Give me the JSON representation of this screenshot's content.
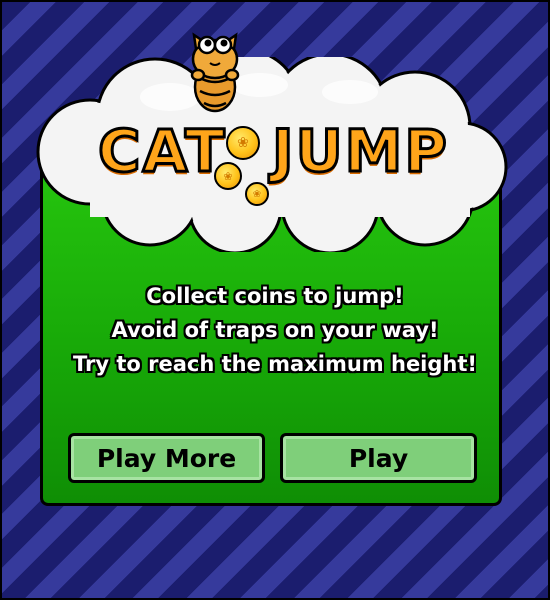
{
  "title": {
    "word_left": "CAT",
    "word_right": "JUMP"
  },
  "instructions": [
    "Collect coins to jump!",
    "Avoid of traps on your way!",
    "Try to reach the maximum height!"
  ],
  "buttons": {
    "play_more": "Play More",
    "play": "Play"
  },
  "colors": {
    "background_dark": "#1b1d6e",
    "background_light": "#363a9c",
    "panel_green": "#18aa08",
    "button_green": "#7fcf7a",
    "logo_orange": "#ffa51a",
    "coin_gold": "#ffc21a"
  },
  "icons": [
    "cat-character-icon",
    "paw-coin-icon",
    "cloud-icon"
  ]
}
